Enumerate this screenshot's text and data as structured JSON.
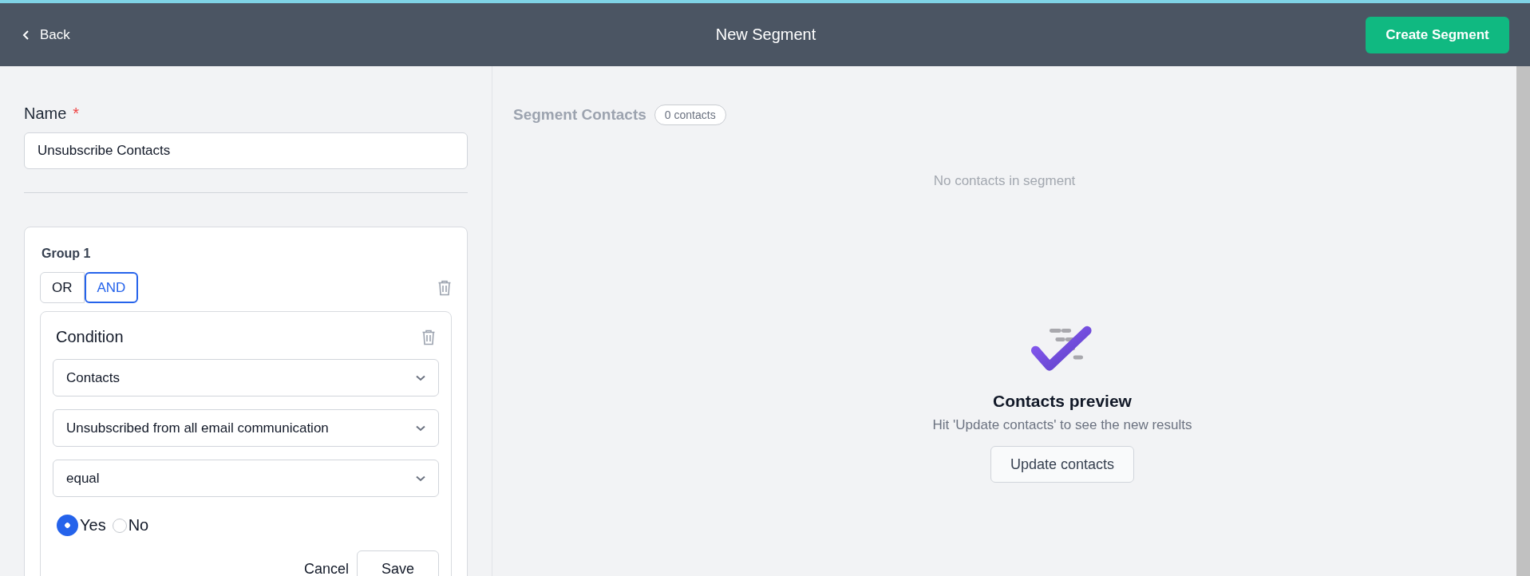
{
  "header": {
    "back": "Back",
    "title": "New Segment",
    "action": "Create Segment"
  },
  "name_field": {
    "label": "Name",
    "required_mark": "*",
    "value": "Unsubscribe Contacts"
  },
  "group": {
    "title": "Group 1",
    "operators": [
      {
        "label": "OR",
        "selected": false
      },
      {
        "label": "AND",
        "selected": true
      }
    ],
    "condition": {
      "title": "Condition",
      "selects": [
        "Contacts",
        "Unsubscribed from all email communication",
        "equal"
      ],
      "options": [
        {
          "label": "Yes",
          "selected": true
        },
        {
          "label": "No",
          "selected": false
        }
      ],
      "buttons": [
        {
          "label": "Cancel",
          "kind": "text"
        },
        {
          "label": "Save",
          "kind": "outline"
        }
      ]
    }
  },
  "segment": {
    "title": "Segment Contacts",
    "count": "0 contacts",
    "empty": "No contacts in segment",
    "preview": {
      "title": "Contacts preview",
      "hint": "Hit 'Update contacts' to see the new results",
      "button": "Update contacts"
    }
  }
}
